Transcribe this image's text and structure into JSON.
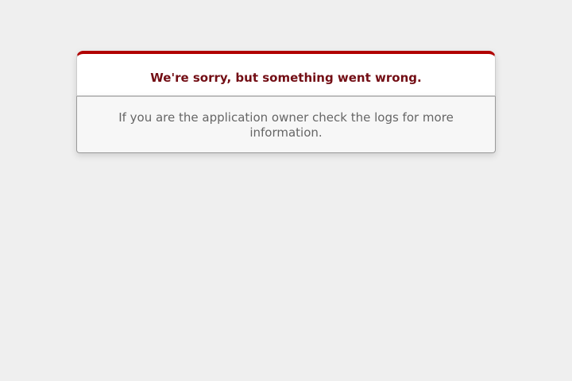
{
  "error": {
    "title": "We're sorry, but something went wrong.",
    "message": "If you are the application owner check the logs for more information."
  },
  "colors": {
    "background": "#EFEFEF",
    "accent_border": "#B00100",
    "title_text": "#730E15",
    "message_text": "#666666"
  }
}
